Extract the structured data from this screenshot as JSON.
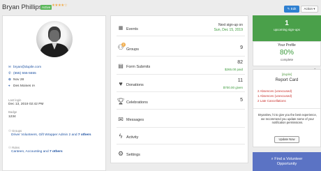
{
  "header": {
    "name": "Bryan Phillips",
    "badge": "Active",
    "stars": "★★★★☆",
    "edit_label": "Edit",
    "action_label": "Action ▾"
  },
  "contact": {
    "email": "bryan@dupile.com",
    "phone": "(555) 555-5555",
    "birthday": "Nov 28",
    "location": "Des Moines IA",
    "last_login_label": "Last login",
    "last_login": "Dec 13, 2019 02:42 PM",
    "badge_label": "Badge",
    "badge_number": "1234",
    "groups_label": "Groups",
    "groups": [
      "Driver Volunteers, Gift Wrapper Admin 2 and ",
      "7 others"
    ],
    "roles_label": "Roles",
    "roles": [
      "Canteen, Accounting and ",
      "7 others"
    ]
  },
  "summary": {
    "events_label": "Events",
    "next_signup_label": "Next sign-up on",
    "next_signup_date": "Sun, Dec 15, 2019",
    "groups_label": "Groups",
    "groups_badge": "2",
    "groups_count": "9",
    "forms_label": "Form Submits",
    "forms_count": "82",
    "forms_amount": "$265.00 paid",
    "donations_label": "Donations",
    "donations_count": "11",
    "donations_amount": "$700.00 given",
    "celebrations_label": "Celebrations",
    "celebrations_count": "5",
    "messages_label": "Messages",
    "activity_label": "Activity",
    "settings_label": "Settings"
  },
  "sidebar": {
    "upcoming_count": "1",
    "upcoming_label": "upcoming sign-ups",
    "profile_label": "Your Profile",
    "profile_percent": "80%",
    "complete_label": "complete",
    "logo_text": "[dupile]",
    "report_title": "Report Card",
    "absences_unexcused_1": "2 Absences (unexcused)",
    "absences_unexcused_2": "1 Absences (unexcused)",
    "late_cancellations": "2 Late Cancellations",
    "note": "BryanDev, hi to give you the best experience, we recommend you update some of your notification permissions.",
    "update_button": "Update Now",
    "find_opportunity_line1": "Find a Volunteer",
    "find_opportunity_line2": "Opportunity"
  },
  "colors": {
    "green": "#4aa04a",
    "blue_button": "#2f80d1",
    "link": "#1a4fa0",
    "danger": "#c9302c",
    "find_box": "#5b73c4"
  },
  "icons": [
    "mail-icon",
    "phone-icon",
    "gift-icon",
    "map-pin-icon",
    "calendar-icon",
    "users-icon",
    "form-icon",
    "heart-icon",
    "trophy-icon",
    "chat-icon",
    "activity-icon",
    "gear-icon",
    "lock-icon"
  ]
}
